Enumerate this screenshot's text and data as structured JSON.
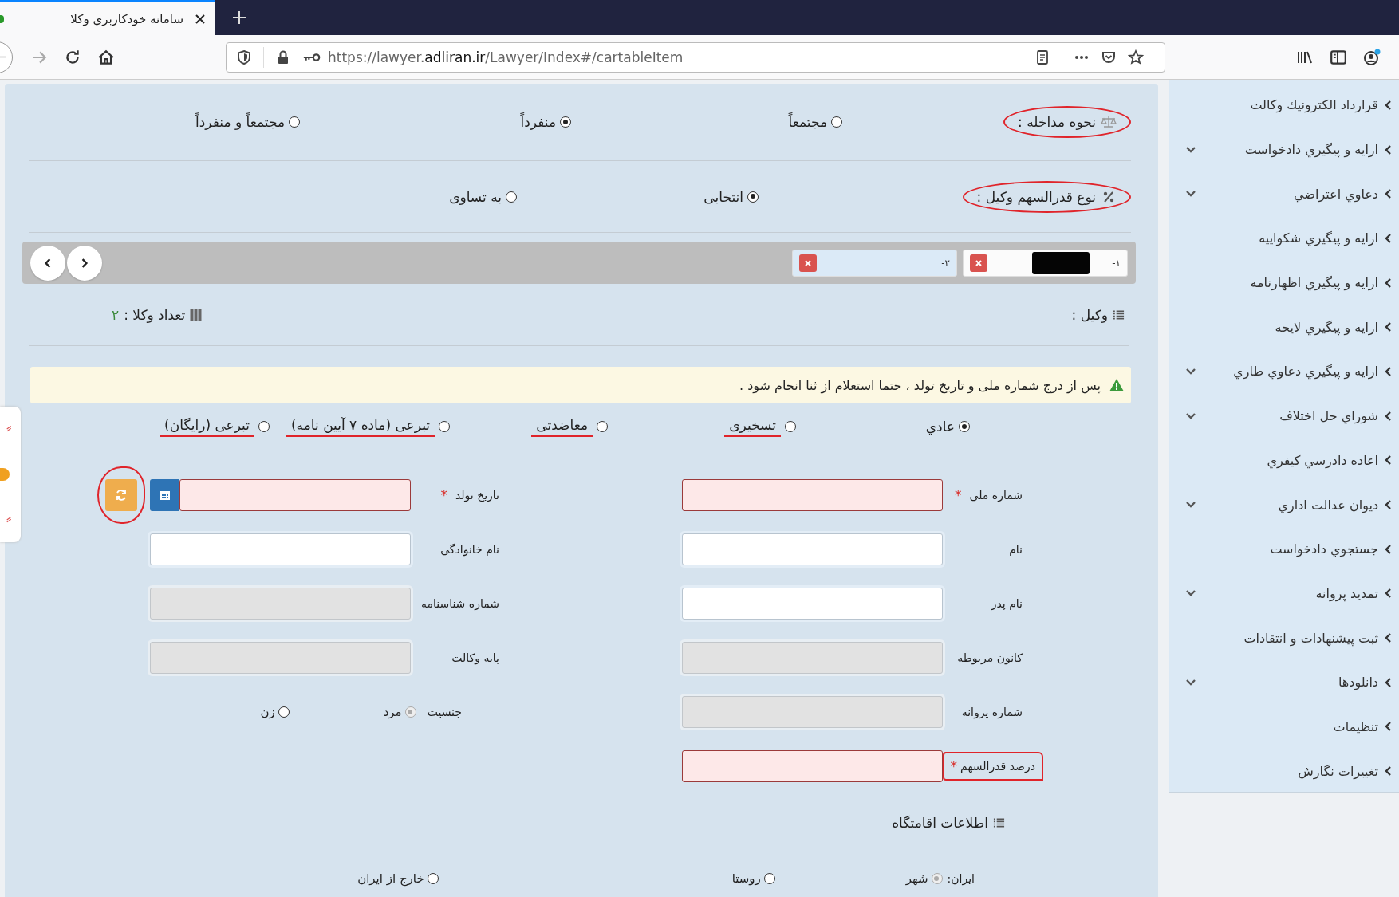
{
  "browser": {
    "tab_title": "سامانه خودکاربری وکلا",
    "url": {
      "start": "https://lawyer.",
      "domain": "adliran.ir",
      "path": "/Lawyer/Index#/cartableItem"
    }
  },
  "sidebar": {
    "items": [
      {
        "label": "قرارداد الكترونيك وكالت",
        "has_submenu": false
      },
      {
        "label": "ارايه و پيگيري دادخواست",
        "has_submenu": true
      },
      {
        "label": "دعاوي اعتراضي",
        "has_submenu": true
      },
      {
        "label": "ارايه و پيگيري شكواييه",
        "has_submenu": false
      },
      {
        "label": "ارايه و پيگيري اظهارنامه",
        "has_submenu": false
      },
      {
        "label": "ارايه و پيگيري لايحه",
        "has_submenu": false
      },
      {
        "label": "ارايه و پيگيري دعاوي طاري",
        "has_submenu": true
      },
      {
        "label": "شوراي حل اختلاف",
        "has_submenu": true
      },
      {
        "label": "اعاده دادرسي كيفري",
        "has_submenu": false
      },
      {
        "label": "ديوان عدالت اداري",
        "has_submenu": true
      },
      {
        "label": "جستجوي دادخواست",
        "has_submenu": false
      },
      {
        "label": "تمديد پروانه",
        "has_submenu": true
      },
      {
        "label": "ثبت پيشنهادات و انتقادات",
        "has_submenu": false
      },
      {
        "label": "دانلودها",
        "has_submenu": true
      },
      {
        "label": "تنظيمات",
        "has_submenu": false
      },
      {
        "label": "تغييرات نگارش",
        "has_submenu": false
      }
    ]
  },
  "choice_groups": [
    {
      "label": "نحوه مداخله :",
      "circled": true,
      "options": [
        {
          "label": "مجتمعاً",
          "selected": false
        },
        {
          "label": "منفرداً",
          "selected": true
        },
        {
          "label": "مجتمعاً و منفرداً",
          "selected": false
        }
      ]
    },
    {
      "label": "نوع قدرالسهم وکیل :",
      "circled": true,
      "options": [
        {
          "label": "انتخابی",
          "selected": true
        },
        {
          "label": "به تساوی",
          "selected": false
        }
      ]
    }
  ],
  "lawyer_tabs": [
    {
      "number": "۱-",
      "redacted": true,
      "selected": false
    },
    {
      "number": "۲-",
      "redacted": false,
      "selected": true
    }
  ],
  "lawyer_header": {
    "label": "وکیل :",
    "count_label": "تعداد وکلا :",
    "count": "۲"
  },
  "alert": "پس از درج شماره ملی و تاریخ تولد ، حتما استعلام از ثنا انجام شود .",
  "lawyer_types": [
    {
      "label": "عادي",
      "selected": true,
      "underlined": false
    },
    {
      "label": "تسخیری",
      "selected": false,
      "underlined": true
    },
    {
      "label": "معاضدتی",
      "selected": false,
      "underlined": true
    },
    {
      "label": "تبرعی (ماده ۷ آیین نامه)",
      "selected": false,
      "underlined": true
    },
    {
      "label": "تبرعی (رایگان)",
      "selected": false,
      "underlined": true
    }
  ],
  "form_rows": [
    {
      "right": {
        "kind": "text",
        "label": "شماره ملی",
        "required": true,
        "required_mark": "*",
        "disabled": false,
        "circled": false
      },
      "left": {
        "kind": "date",
        "label": "تاریخ تولد",
        "required": true,
        "required_mark": "*",
        "disabled": false,
        "circled": false,
        "refresh_circled": true
      }
    },
    {
      "right": {
        "kind": "text",
        "label": "نام",
        "required": false,
        "disabled": false,
        "circled": false
      },
      "left": {
        "kind": "text",
        "label": "نام خانوادگی",
        "required": false,
        "disabled": false,
        "circled": false
      }
    },
    {
      "right": {
        "kind": "text",
        "label": "نام پدر",
        "required": false,
        "disabled": false,
        "circled": false
      },
      "left": {
        "kind": "text",
        "label": "شماره شناسنامه",
        "required": false,
        "disabled": true,
        "circled": false
      }
    },
    {
      "right": {
        "kind": "text",
        "label": "کانون مربوطه",
        "required": false,
        "disabled": true,
        "circled": false
      },
      "left": {
        "kind": "text",
        "label": "پایه وکالت",
        "required": false,
        "disabled": true,
        "circled": false
      }
    },
    {
      "right": {
        "kind": "text",
        "label": "شماره پروانه",
        "required": false,
        "disabled": true,
        "circled": false
      },
      "left": {
        "kind": "radio",
        "label": "جنسیت",
        "options": [
          {
            "label": "مرد",
            "selected": true,
            "disabled": true
          },
          {
            "label": "زن",
            "selected": false,
            "disabled": false
          }
        ]
      }
    },
    {
      "right": {
        "kind": "text",
        "label": "درصد قدرالسهم",
        "required": true,
        "required_mark": "*",
        "disabled": false,
        "circled": true
      }
    }
  ],
  "residence": {
    "title": "اطلاعات اقامتگاه",
    "label": "ایران:",
    "options": [
      {
        "label": "شهر",
        "selected": true,
        "disabled": true
      },
      {
        "label": "روستا",
        "selected": false,
        "disabled": false
      },
      {
        "label": "خارج از ایران",
        "selected": false,
        "disabled": false
      }
    ]
  }
}
